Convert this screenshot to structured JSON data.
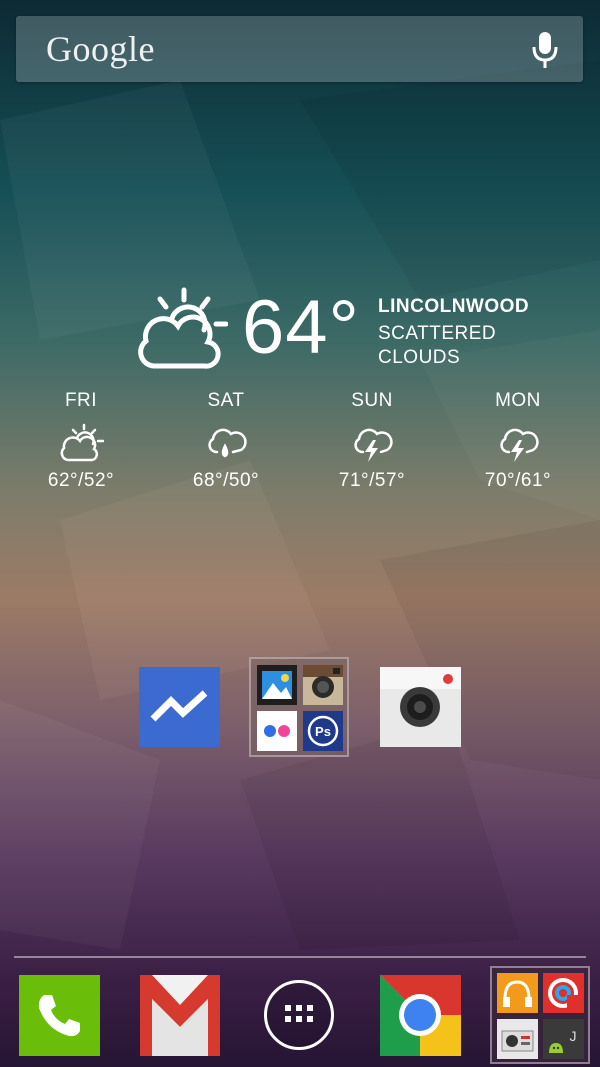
{
  "search": {
    "logo": "Google",
    "mic_icon": "microphone-icon"
  },
  "weather": {
    "current": {
      "temp": "64°",
      "city": "LINCOLNWOOD",
      "condition": "SCATTERED CLOUDS",
      "icon": "partly-cloudy-icon"
    },
    "forecast": [
      {
        "day": "FRI",
        "range": "62°/52°",
        "icon": "partly-cloudy-icon"
      },
      {
        "day": "SAT",
        "range": "68°/50°",
        "icon": "rain-cloud-icon"
      },
      {
        "day": "SUN",
        "range": "71°/57°",
        "icon": "thunderstorm-icon"
      },
      {
        "day": "MON",
        "range": "70°/61°",
        "icon": "thunderstorm-icon"
      }
    ]
  },
  "home_apps": [
    {
      "name": "Messenger",
      "icon": "messenger-icon",
      "color": "#3b6ad0"
    },
    {
      "name": "Folder",
      "icon": "folder-icon",
      "contents": [
        "gallery-icon",
        "instagram-icon",
        "flickr-icon",
        "photoshop-express-icon"
      ]
    },
    {
      "name": "Camera",
      "icon": "camera-icon",
      "color": "#e9e9e9"
    }
  ],
  "dock": [
    {
      "name": "Phone",
      "icon": "phone-icon",
      "color": "#6abd09"
    },
    {
      "name": "Gmail",
      "icon": "gmail-icon"
    },
    {
      "name": "App drawer",
      "icon": "app-drawer-icon"
    },
    {
      "name": "Chrome",
      "icon": "chrome-icon"
    },
    {
      "name": "Folder",
      "icon": "folder-icon",
      "contents": [
        "headphones-icon",
        "music-icon",
        "radio-icon",
        "android-icon"
      ]
    }
  ]
}
